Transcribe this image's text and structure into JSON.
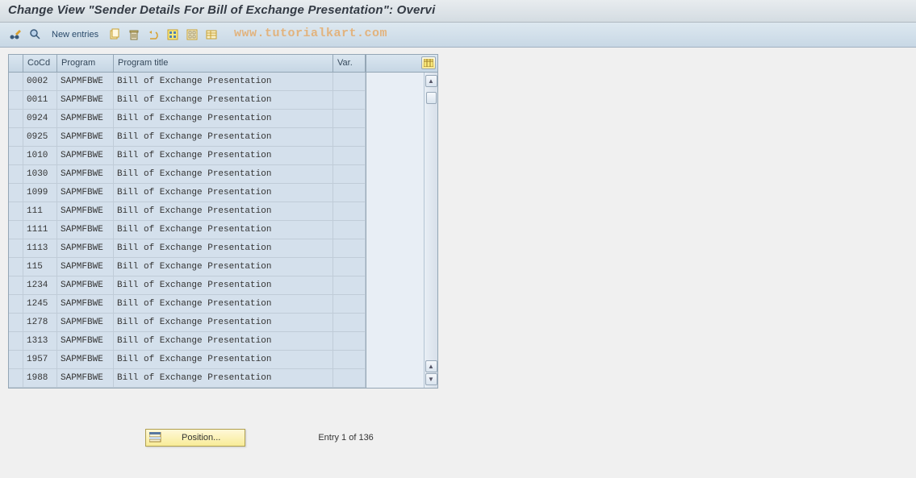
{
  "header": {
    "title": "Change View \"Sender Details For Bill of Exchange Presentation\": Overvi"
  },
  "toolbar": {
    "new_entries_label": "New entries"
  },
  "watermark": "www.tutorialkart.com",
  "table": {
    "columns": {
      "cocd": "CoCd",
      "program": "Program",
      "program_title": "Program title",
      "var": "Var."
    },
    "rows": [
      {
        "cocd": "0002",
        "program": "SAPMFBWE",
        "title": "Bill of Exchange Presentation",
        "var": ""
      },
      {
        "cocd": "0011",
        "program": "SAPMFBWE",
        "title": "Bill of Exchange Presentation",
        "var": ""
      },
      {
        "cocd": "0924",
        "program": "SAPMFBWE",
        "title": "Bill of Exchange Presentation",
        "var": ""
      },
      {
        "cocd": "0925",
        "program": "SAPMFBWE",
        "title": "Bill of Exchange Presentation",
        "var": ""
      },
      {
        "cocd": "1010",
        "program": "SAPMFBWE",
        "title": "Bill of Exchange Presentation",
        "var": ""
      },
      {
        "cocd": "1030",
        "program": "SAPMFBWE",
        "title": "Bill of Exchange Presentation",
        "var": ""
      },
      {
        "cocd": "1099",
        "program": "SAPMFBWE",
        "title": "Bill of Exchange Presentation",
        "var": ""
      },
      {
        "cocd": "111",
        "program": "SAPMFBWE",
        "title": "Bill of Exchange Presentation",
        "var": ""
      },
      {
        "cocd": "1111",
        "program": "SAPMFBWE",
        "title": "Bill of Exchange Presentation",
        "var": ""
      },
      {
        "cocd": "1113",
        "program": "SAPMFBWE",
        "title": "Bill of Exchange Presentation",
        "var": ""
      },
      {
        "cocd": "115",
        "program": "SAPMFBWE",
        "title": "Bill of Exchange Presentation",
        "var": ""
      },
      {
        "cocd": "1234",
        "program": "SAPMFBWE",
        "title": "Bill of Exchange Presentation",
        "var": ""
      },
      {
        "cocd": "1245",
        "program": "SAPMFBWE",
        "title": "Bill of Exchange Presentation",
        "var": ""
      },
      {
        "cocd": "1278",
        "program": "SAPMFBWE",
        "title": "Bill of Exchange Presentation",
        "var": ""
      },
      {
        "cocd": "1313",
        "program": "SAPMFBWE",
        "title": "Bill of Exchange Presentation",
        "var": ""
      },
      {
        "cocd": "1957",
        "program": "SAPMFBWE",
        "title": "Bill of Exchange Presentation",
        "var": ""
      },
      {
        "cocd": "1988",
        "program": "SAPMFBWE",
        "title": "Bill of Exchange Presentation",
        "var": ""
      }
    ]
  },
  "footer": {
    "position_label": "Position...",
    "entry_status": "Entry 1 of 136"
  }
}
